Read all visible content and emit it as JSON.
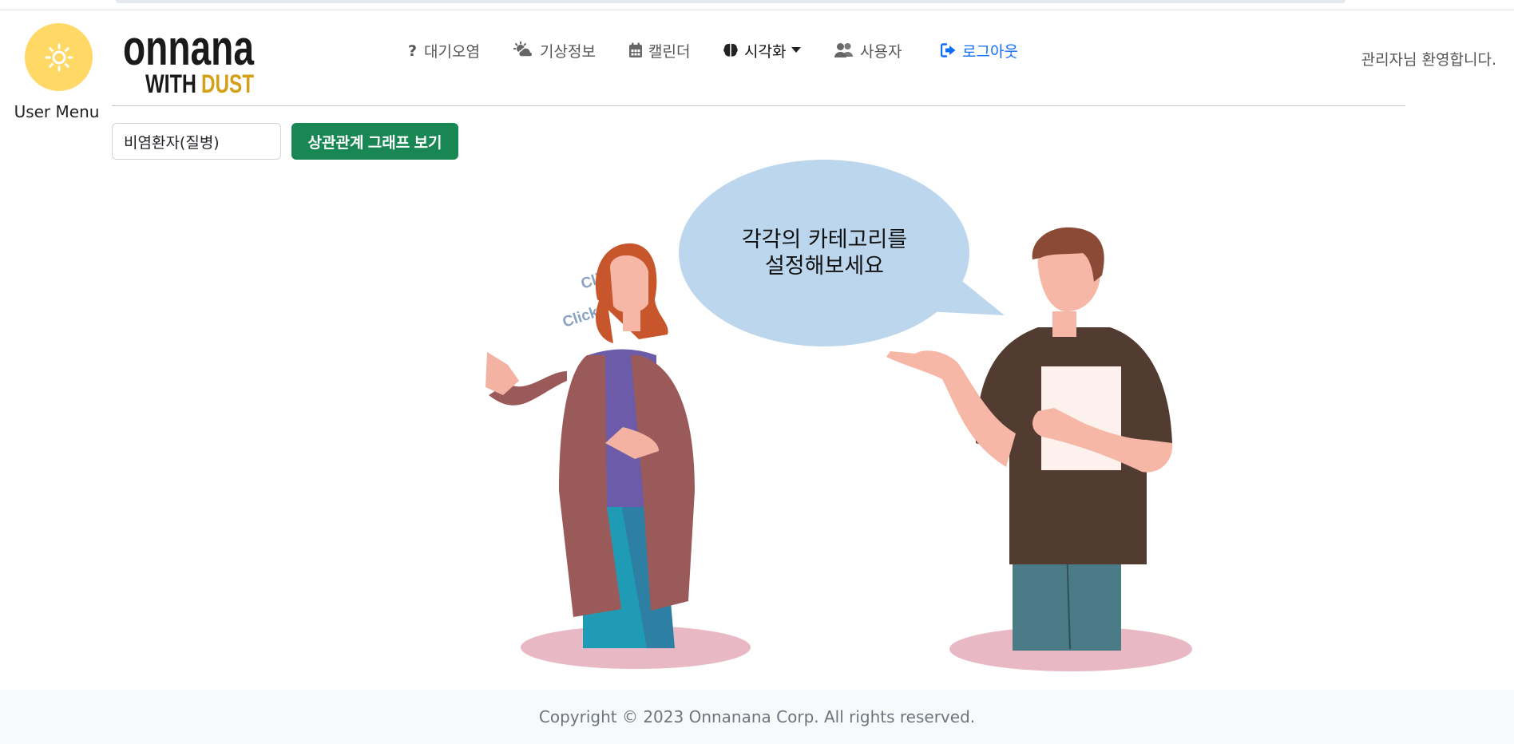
{
  "header": {
    "user_menu_label": "User Menu",
    "logo": {
      "line1": "onnana",
      "line2_a": "WITH",
      "line2_b": "DUST"
    },
    "nav": [
      {
        "label": "대기오염",
        "icon": "question-icon"
      },
      {
        "label": "기상정보",
        "icon": "cloud-sun-icon"
      },
      {
        "label": "캘린더",
        "icon": "calendar-icon"
      },
      {
        "label": "시각화",
        "icon": "brain-icon",
        "dropdown": true
      },
      {
        "label": "사용자",
        "icon": "users-icon"
      },
      {
        "label": "로그아웃",
        "icon": "logout-icon"
      }
    ],
    "welcome": "관리자님 환영합니다."
  },
  "controls": {
    "select_value": "비염환자(질병)",
    "graph_button": "상관관계 그래프 보기"
  },
  "illustration": {
    "bubble_line1": "각각의 카테고리를",
    "bubble_line2": "설정해보세요",
    "click1": "Click!",
    "click2": "Click!"
  },
  "footer": {
    "copyright": "Copyright © 2023 Onnanana Corp. All rights reserved."
  },
  "colors": {
    "accent_green": "#198754",
    "link_blue": "#0d6efd",
    "avatar_yellow": "#ffd866",
    "logo_gold": "#d4a017",
    "bubble": "#bcd6ee"
  }
}
